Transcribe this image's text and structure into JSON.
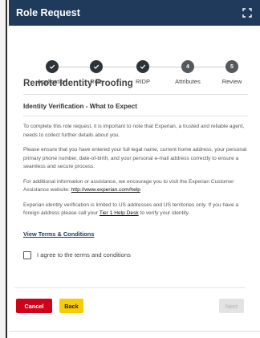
{
  "header": {
    "title": "Role Request",
    "expand_icon": "expand-icon"
  },
  "steps": [
    {
      "label": "Application",
      "status": "complete"
    },
    {
      "label": "Role",
      "status": "complete"
    },
    {
      "label": "RIDP",
      "status": "complete"
    },
    {
      "label": "Attributes",
      "status": "pending",
      "number": "4"
    },
    {
      "label": "Review",
      "status": "pending",
      "number": "5"
    }
  ],
  "content": {
    "title": "Remote Identity Proofing",
    "subtitle": "Identity Verification - What to Expect",
    "p1": "To complete this role request, it is important to note that Experian, a trusted and reliable agent, needs to collect further details about you.",
    "p2": "Please ensure that you have entered your full legal name, current home address, your personal primary phone number, date-of-birth, and your personal e-mail address correctly to ensure a seamless and secure process.",
    "p3_text": "For additional information or assistance, we encourage you to visit the Experian Customer Assistance website: ",
    "p3_link": "http://www.experian.com/help",
    "p4_text": "Experian identity verification is limited to US addresses and US territories only. If you have a foreign address please call your ",
    "p4_link": "Tier 1 Help Desk",
    "p4_text2": " to verify your identity.",
    "terms_link": "View Terms & Conditions",
    "agree_label": "I agree to the terms and conditions"
  },
  "footer": {
    "cancel_label": "Cancel",
    "back_label": "Back",
    "next_label": "Next"
  },
  "colors": {
    "header_bg": "#1f3a5a",
    "step_complete": "#2d3338",
    "cancel": "#d0021b",
    "back": "#f7cc00",
    "next_disabled": "#e3e3e3"
  }
}
